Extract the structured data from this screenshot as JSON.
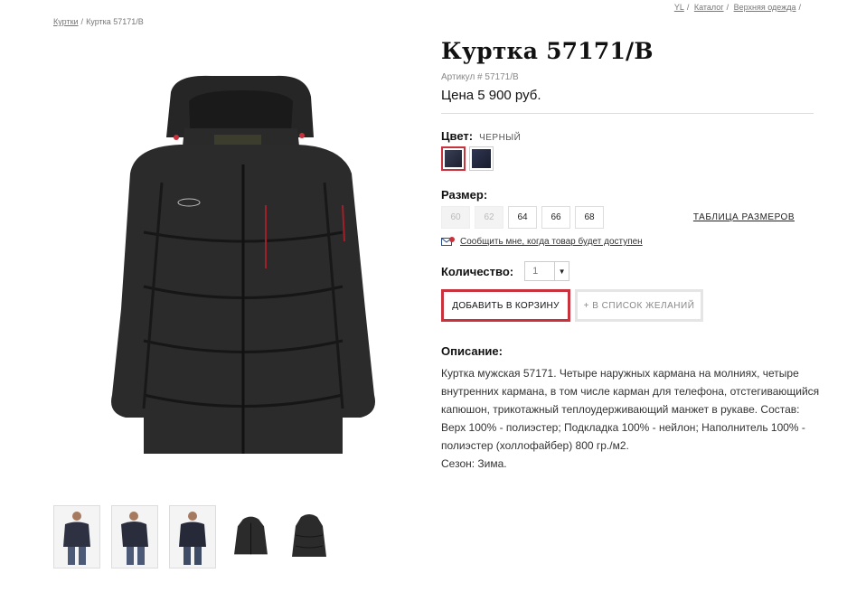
{
  "top_breadcrumb": [
    "YL",
    "Каталог",
    "Верхняя одежда"
  ],
  "breadcrumb": {
    "parent": "Куртки",
    "current": "Куртка 57171/В"
  },
  "product": {
    "title": "Куртка 57171/В",
    "sku": "Артикул # 57171/В",
    "price": "Цена 5 900 руб."
  },
  "color": {
    "label": "Цвет:",
    "value": "ЧЕРНЫЙ"
  },
  "size": {
    "label": "Размер:",
    "options": [
      "60",
      "62",
      "64",
      "66",
      "68"
    ],
    "table_link": "ТАБЛИЦА РАЗМЕРОВ"
  },
  "notify_text": "Сообщить мне, когда товар будет доступен",
  "quantity": {
    "label": "Количество:",
    "value": "1"
  },
  "buttons": {
    "cart": "ДОБАВИТЬ В КОРЗИНУ",
    "wishlist": "+ В СПИСОК ЖЕЛАНИЙ"
  },
  "description": {
    "title": "Описание:",
    "text": "Куртка мужская 57171. Четыре наружных кармана на молниях, четыре внутренних кармана, в том числе карман для телефона, отстегивающийся капюшон, трикотажный теплоудерживающий манжет в рукаве. Состав: Верх 100% - полиэстер; Подкладка 100% - нейлон; Наполнитель 100% - полиэстер (холлофайбер) 800 гр./м2.",
    "season": "Сезон: Зима."
  },
  "colors": {
    "accent": "#c8323c",
    "jacket": "#2b2b2b"
  }
}
